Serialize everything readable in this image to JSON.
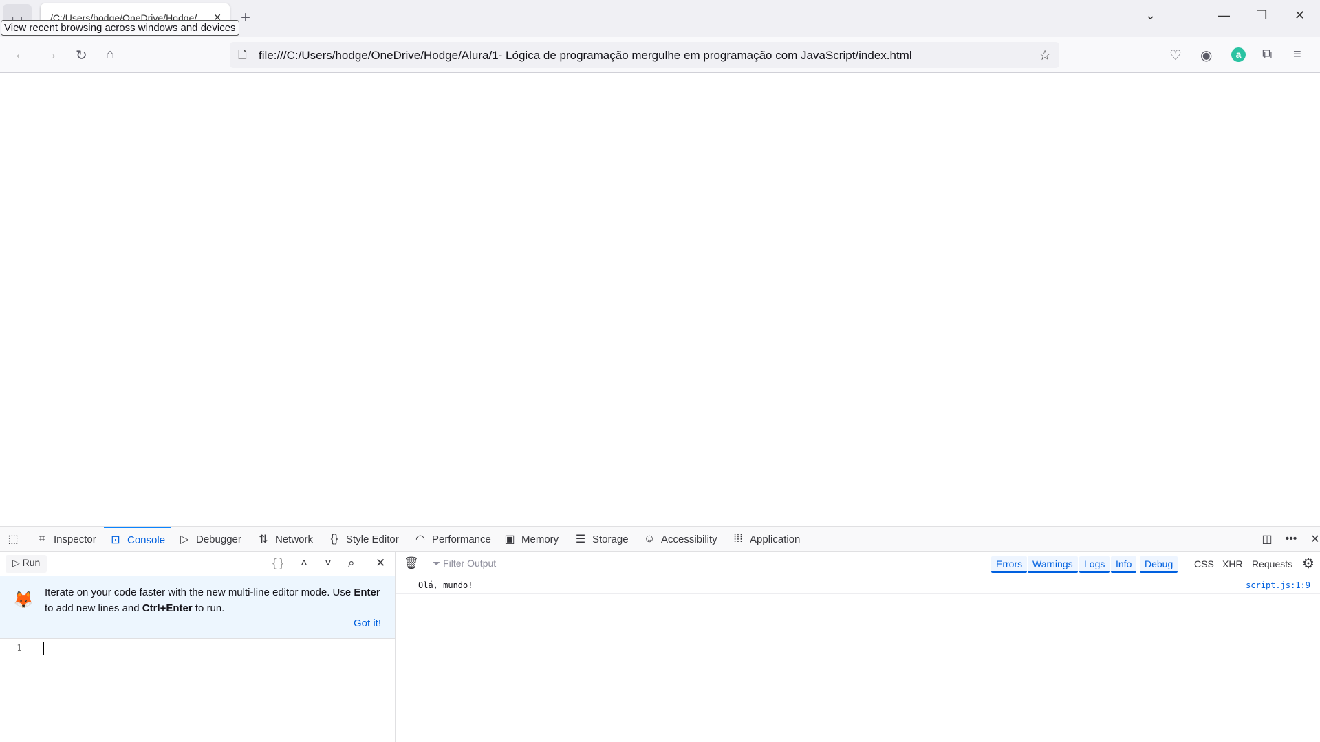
{
  "browser": {
    "tab_title": "/C:/Users/hodge/OneDrive/Hodge/",
    "tooltip": "View recent browsing across windows and devices",
    "url": "file:///C:/Users/hodge/OneDrive/Hodge/Alura/1- Lógica de programação mergulhe em programação com JavaScript/index.html",
    "extension_badge": "a"
  },
  "devtools": {
    "tabs": [
      {
        "label": "Inspector",
        "icon": "inspector-icon"
      },
      {
        "label": "Console",
        "icon": "console-icon",
        "selected": true
      },
      {
        "label": "Debugger",
        "icon": "debugger-icon"
      },
      {
        "label": "Network",
        "icon": "network-icon"
      },
      {
        "label": "Style Editor",
        "icon": "style-editor-icon"
      },
      {
        "label": "Performance",
        "icon": "performance-icon"
      },
      {
        "label": "Memory",
        "icon": "memory-icon"
      },
      {
        "label": "Storage",
        "icon": "storage-icon"
      },
      {
        "label": "Accessibility",
        "icon": "accessibility-icon"
      },
      {
        "label": "Application",
        "icon": "application-icon"
      }
    ],
    "run_label": "Run",
    "filter_placeholder": "Filter Output",
    "filters": [
      "Errors",
      "Warnings",
      "Logs",
      "Info",
      "Debug"
    ],
    "extra_filters": [
      "CSS",
      "XHR",
      "Requests"
    ],
    "notice": {
      "text1": "Iterate on your code faster with the new multi-line editor mode. Use ",
      "bold1": "Enter",
      "text2": " to add new lines and ",
      "bold2": "Ctrl+Enter",
      "text3": " to run.",
      "got_it": "Got it!"
    },
    "line_number": "1",
    "messages": [
      {
        "text": "Olá, mundo!",
        "source": "script.js:1:9"
      }
    ]
  },
  "colors": {
    "accent": "#0060df",
    "extension": "#2ac3a2"
  }
}
